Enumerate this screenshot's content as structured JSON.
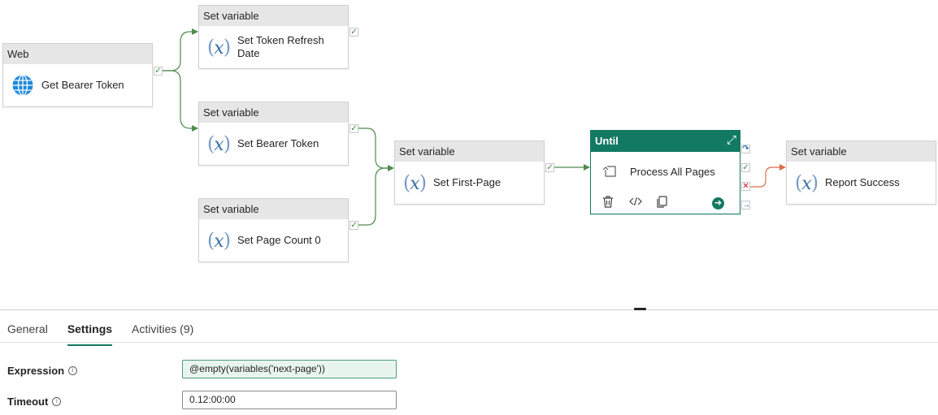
{
  "pipeline": {
    "web": {
      "type": "Web",
      "name": "Get Bearer Token"
    },
    "set_token_refresh": {
      "type": "Set variable",
      "name": "Set Token Refresh Date"
    },
    "set_bearer": {
      "type": "Set variable",
      "name": "Set Bearer Token"
    },
    "set_page_count": {
      "type": "Set variable",
      "name": "Set Page Count 0"
    },
    "set_first_page": {
      "type": "Set variable",
      "name": "Set First-Page"
    },
    "until": {
      "type": "Until",
      "name": "Process All Pages"
    },
    "report_success": {
      "type": "Set variable",
      "name": "Report Success"
    }
  },
  "port_icons": {
    "success": "✓",
    "failure": "✕",
    "skipped": "↷",
    "completion": "→"
  },
  "colors": {
    "success_link": "#4f8a4f",
    "failure_link": "#d9704a",
    "until_header": "#127a62"
  },
  "tabs": [
    {
      "label": "General"
    },
    {
      "label": "Settings"
    },
    {
      "label": "Activities (9)"
    }
  ],
  "active_tab": "Settings",
  "settings": {
    "expression_label": "Expression",
    "expression_value": "@empty(variables('next-page'))",
    "timeout_label": "Timeout",
    "timeout_value": "0.12:00:00"
  }
}
